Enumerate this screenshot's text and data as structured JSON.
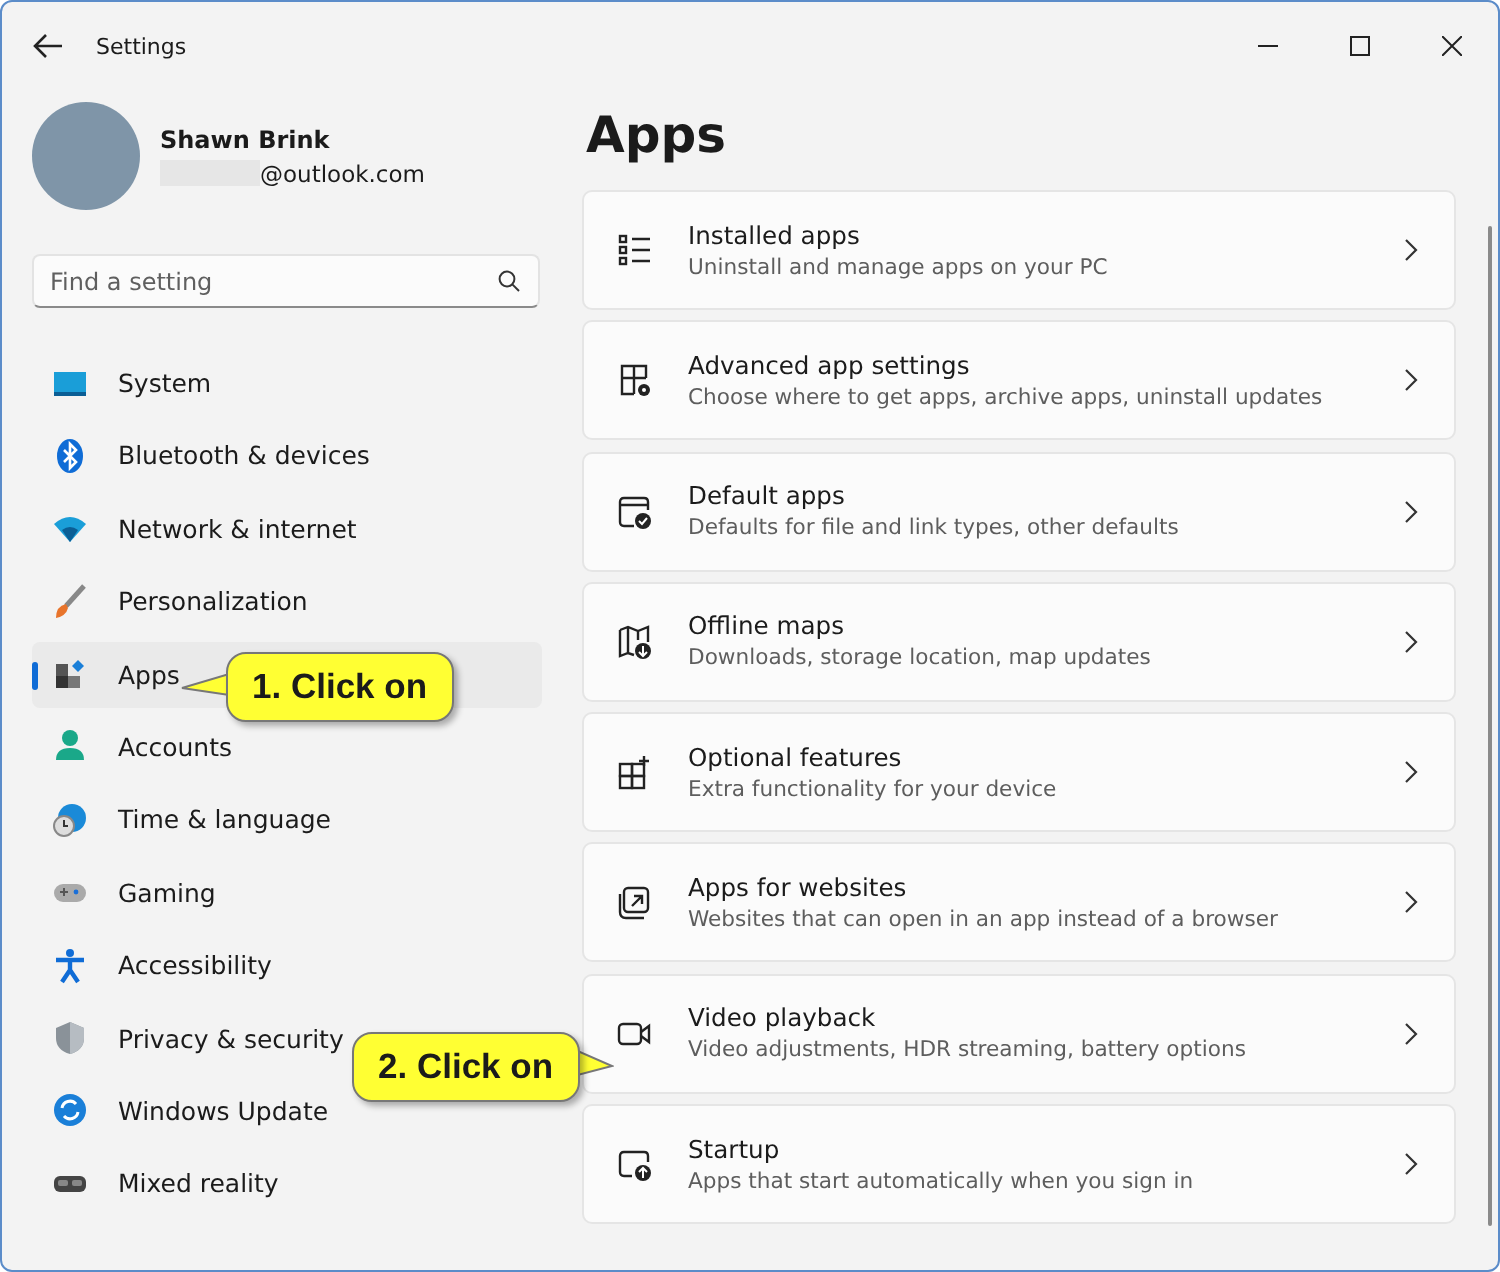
{
  "window": {
    "title": "Settings"
  },
  "profile": {
    "name": "Shawn Brink",
    "email": "@outlook.com"
  },
  "search": {
    "placeholder": "Find a setting"
  },
  "sidebar": {
    "items": [
      {
        "label": "System",
        "selected": false
      },
      {
        "label": "Bluetooth & devices",
        "selected": false
      },
      {
        "label": "Network & internet",
        "selected": false
      },
      {
        "label": "Personalization",
        "selected": false
      },
      {
        "label": "Apps",
        "selected": true
      },
      {
        "label": "Accounts",
        "selected": false
      },
      {
        "label": "Time & language",
        "selected": false
      },
      {
        "label": "Gaming",
        "selected": false
      },
      {
        "label": "Accessibility",
        "selected": false
      },
      {
        "label": "Privacy & security",
        "selected": false
      },
      {
        "label": "Windows Update",
        "selected": false
      },
      {
        "label": "Mixed reality",
        "selected": false
      }
    ]
  },
  "page": {
    "title": "Apps",
    "cards": [
      {
        "title": "Installed apps",
        "description": "Uninstall and manage apps on your PC"
      },
      {
        "title": "Advanced app settings",
        "description": "Choose where to get apps, archive apps, uninstall updates"
      },
      {
        "title": "Default apps",
        "description": "Defaults for file and link types, other defaults"
      },
      {
        "title": "Offline maps",
        "description": "Downloads, storage location, map updates"
      },
      {
        "title": "Optional features",
        "description": "Extra functionality for your device"
      },
      {
        "title": "Apps for websites",
        "description": "Websites that can open in an app instead of a browser"
      },
      {
        "title": "Video playback",
        "description": "Video adjustments, HDR streaming, battery options"
      },
      {
        "title": "Startup",
        "description": "Apps that start automatically when you sign in"
      }
    ]
  },
  "callouts": [
    {
      "text": "1. Click on"
    },
    {
      "text": "2. Click on"
    }
  ]
}
